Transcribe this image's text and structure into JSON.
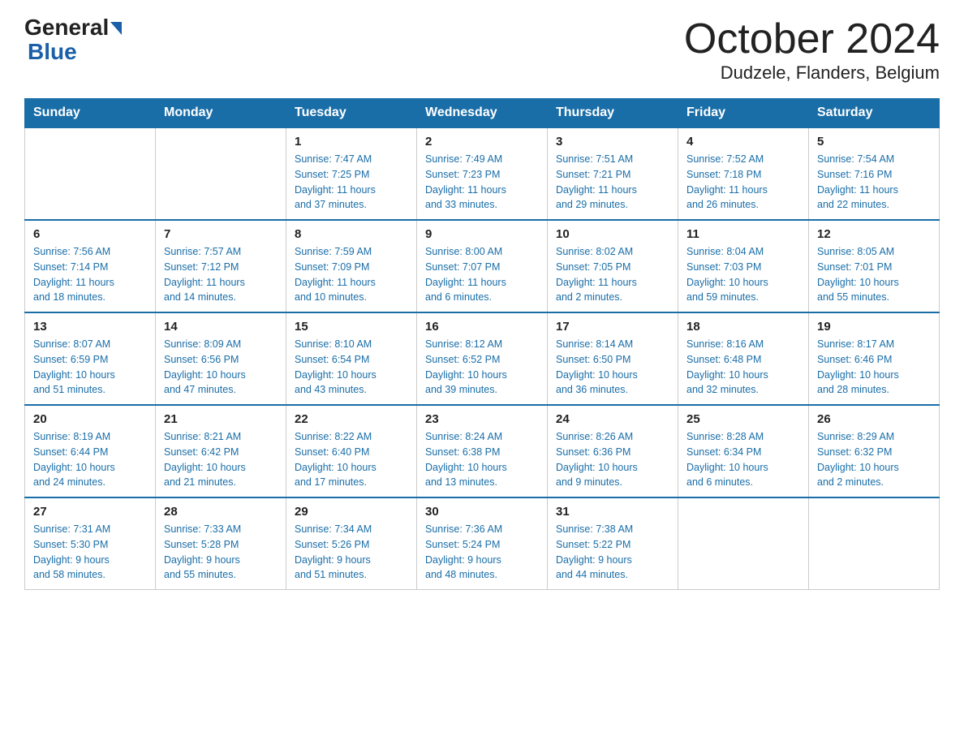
{
  "header": {
    "logo_general": "General",
    "logo_blue": "Blue",
    "month_title": "October 2024",
    "location": "Dudzele, Flanders, Belgium"
  },
  "days_of_week": [
    "Sunday",
    "Monday",
    "Tuesday",
    "Wednesday",
    "Thursday",
    "Friday",
    "Saturday"
  ],
  "weeks": [
    [
      {
        "day": "",
        "info": ""
      },
      {
        "day": "",
        "info": ""
      },
      {
        "day": "1",
        "info": "Sunrise: 7:47 AM\nSunset: 7:25 PM\nDaylight: 11 hours\nand 37 minutes."
      },
      {
        "day": "2",
        "info": "Sunrise: 7:49 AM\nSunset: 7:23 PM\nDaylight: 11 hours\nand 33 minutes."
      },
      {
        "day": "3",
        "info": "Sunrise: 7:51 AM\nSunset: 7:21 PM\nDaylight: 11 hours\nand 29 minutes."
      },
      {
        "day": "4",
        "info": "Sunrise: 7:52 AM\nSunset: 7:18 PM\nDaylight: 11 hours\nand 26 minutes."
      },
      {
        "day": "5",
        "info": "Sunrise: 7:54 AM\nSunset: 7:16 PM\nDaylight: 11 hours\nand 22 minutes."
      }
    ],
    [
      {
        "day": "6",
        "info": "Sunrise: 7:56 AM\nSunset: 7:14 PM\nDaylight: 11 hours\nand 18 minutes."
      },
      {
        "day": "7",
        "info": "Sunrise: 7:57 AM\nSunset: 7:12 PM\nDaylight: 11 hours\nand 14 minutes."
      },
      {
        "day": "8",
        "info": "Sunrise: 7:59 AM\nSunset: 7:09 PM\nDaylight: 11 hours\nand 10 minutes."
      },
      {
        "day": "9",
        "info": "Sunrise: 8:00 AM\nSunset: 7:07 PM\nDaylight: 11 hours\nand 6 minutes."
      },
      {
        "day": "10",
        "info": "Sunrise: 8:02 AM\nSunset: 7:05 PM\nDaylight: 11 hours\nand 2 minutes."
      },
      {
        "day": "11",
        "info": "Sunrise: 8:04 AM\nSunset: 7:03 PM\nDaylight: 10 hours\nand 59 minutes."
      },
      {
        "day": "12",
        "info": "Sunrise: 8:05 AM\nSunset: 7:01 PM\nDaylight: 10 hours\nand 55 minutes."
      }
    ],
    [
      {
        "day": "13",
        "info": "Sunrise: 8:07 AM\nSunset: 6:59 PM\nDaylight: 10 hours\nand 51 minutes."
      },
      {
        "day": "14",
        "info": "Sunrise: 8:09 AM\nSunset: 6:56 PM\nDaylight: 10 hours\nand 47 minutes."
      },
      {
        "day": "15",
        "info": "Sunrise: 8:10 AM\nSunset: 6:54 PM\nDaylight: 10 hours\nand 43 minutes."
      },
      {
        "day": "16",
        "info": "Sunrise: 8:12 AM\nSunset: 6:52 PM\nDaylight: 10 hours\nand 39 minutes."
      },
      {
        "day": "17",
        "info": "Sunrise: 8:14 AM\nSunset: 6:50 PM\nDaylight: 10 hours\nand 36 minutes."
      },
      {
        "day": "18",
        "info": "Sunrise: 8:16 AM\nSunset: 6:48 PM\nDaylight: 10 hours\nand 32 minutes."
      },
      {
        "day": "19",
        "info": "Sunrise: 8:17 AM\nSunset: 6:46 PM\nDaylight: 10 hours\nand 28 minutes."
      }
    ],
    [
      {
        "day": "20",
        "info": "Sunrise: 8:19 AM\nSunset: 6:44 PM\nDaylight: 10 hours\nand 24 minutes."
      },
      {
        "day": "21",
        "info": "Sunrise: 8:21 AM\nSunset: 6:42 PM\nDaylight: 10 hours\nand 21 minutes."
      },
      {
        "day": "22",
        "info": "Sunrise: 8:22 AM\nSunset: 6:40 PM\nDaylight: 10 hours\nand 17 minutes."
      },
      {
        "day": "23",
        "info": "Sunrise: 8:24 AM\nSunset: 6:38 PM\nDaylight: 10 hours\nand 13 minutes."
      },
      {
        "day": "24",
        "info": "Sunrise: 8:26 AM\nSunset: 6:36 PM\nDaylight: 10 hours\nand 9 minutes."
      },
      {
        "day": "25",
        "info": "Sunrise: 8:28 AM\nSunset: 6:34 PM\nDaylight: 10 hours\nand 6 minutes."
      },
      {
        "day": "26",
        "info": "Sunrise: 8:29 AM\nSunset: 6:32 PM\nDaylight: 10 hours\nand 2 minutes."
      }
    ],
    [
      {
        "day": "27",
        "info": "Sunrise: 7:31 AM\nSunset: 5:30 PM\nDaylight: 9 hours\nand 58 minutes."
      },
      {
        "day": "28",
        "info": "Sunrise: 7:33 AM\nSunset: 5:28 PM\nDaylight: 9 hours\nand 55 minutes."
      },
      {
        "day": "29",
        "info": "Sunrise: 7:34 AM\nSunset: 5:26 PM\nDaylight: 9 hours\nand 51 minutes."
      },
      {
        "day": "30",
        "info": "Sunrise: 7:36 AM\nSunset: 5:24 PM\nDaylight: 9 hours\nand 48 minutes."
      },
      {
        "day": "31",
        "info": "Sunrise: 7:38 AM\nSunset: 5:22 PM\nDaylight: 9 hours\nand 44 minutes."
      },
      {
        "day": "",
        "info": ""
      },
      {
        "day": "",
        "info": ""
      }
    ]
  ]
}
